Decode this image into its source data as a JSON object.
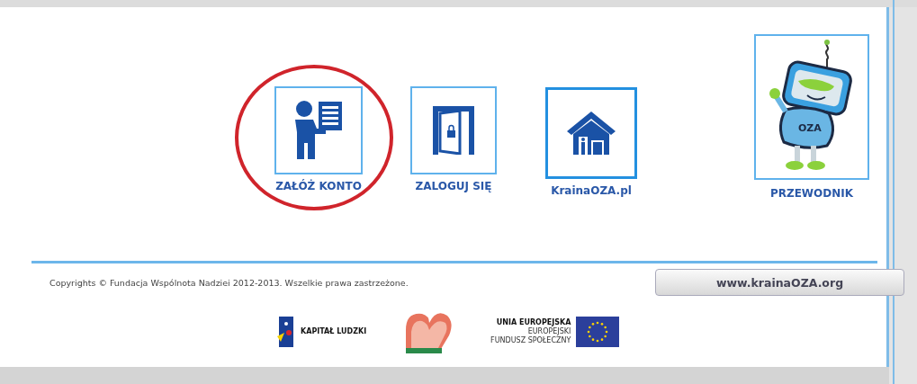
{
  "tiles": [
    {
      "kind": "person-form",
      "label": "ZAŁÓŻ KONTO",
      "highlighted": true
    },
    {
      "kind": "door",
      "label": "ZALOGUJ SIĘ",
      "highlighted": false
    },
    {
      "kind": "house",
      "label": "KrainaOZA.pl",
      "highlighted": false
    },
    {
      "kind": "robot",
      "label": "PRZEWODNIK",
      "highlighted": false,
      "badge": "OZA"
    }
  ],
  "footer": {
    "copyright": "Copyrights © Fundacja Wspólnota Nadziei 2012-2013. Wszelkie prawa zastrzeżone.",
    "site_button": "www.krainaOZA.org"
  },
  "logos": [
    {
      "kind": "kapital",
      "lines": [
        "KAPITAŁ LUDZKI"
      ]
    },
    {
      "kind": "fundacja"
    },
    {
      "kind": "eu",
      "lines": [
        "UNIA EUROPEJSKA",
        "EUROPEJSKI",
        "FUNDUSZ SPOŁECZNY"
      ]
    }
  ]
}
